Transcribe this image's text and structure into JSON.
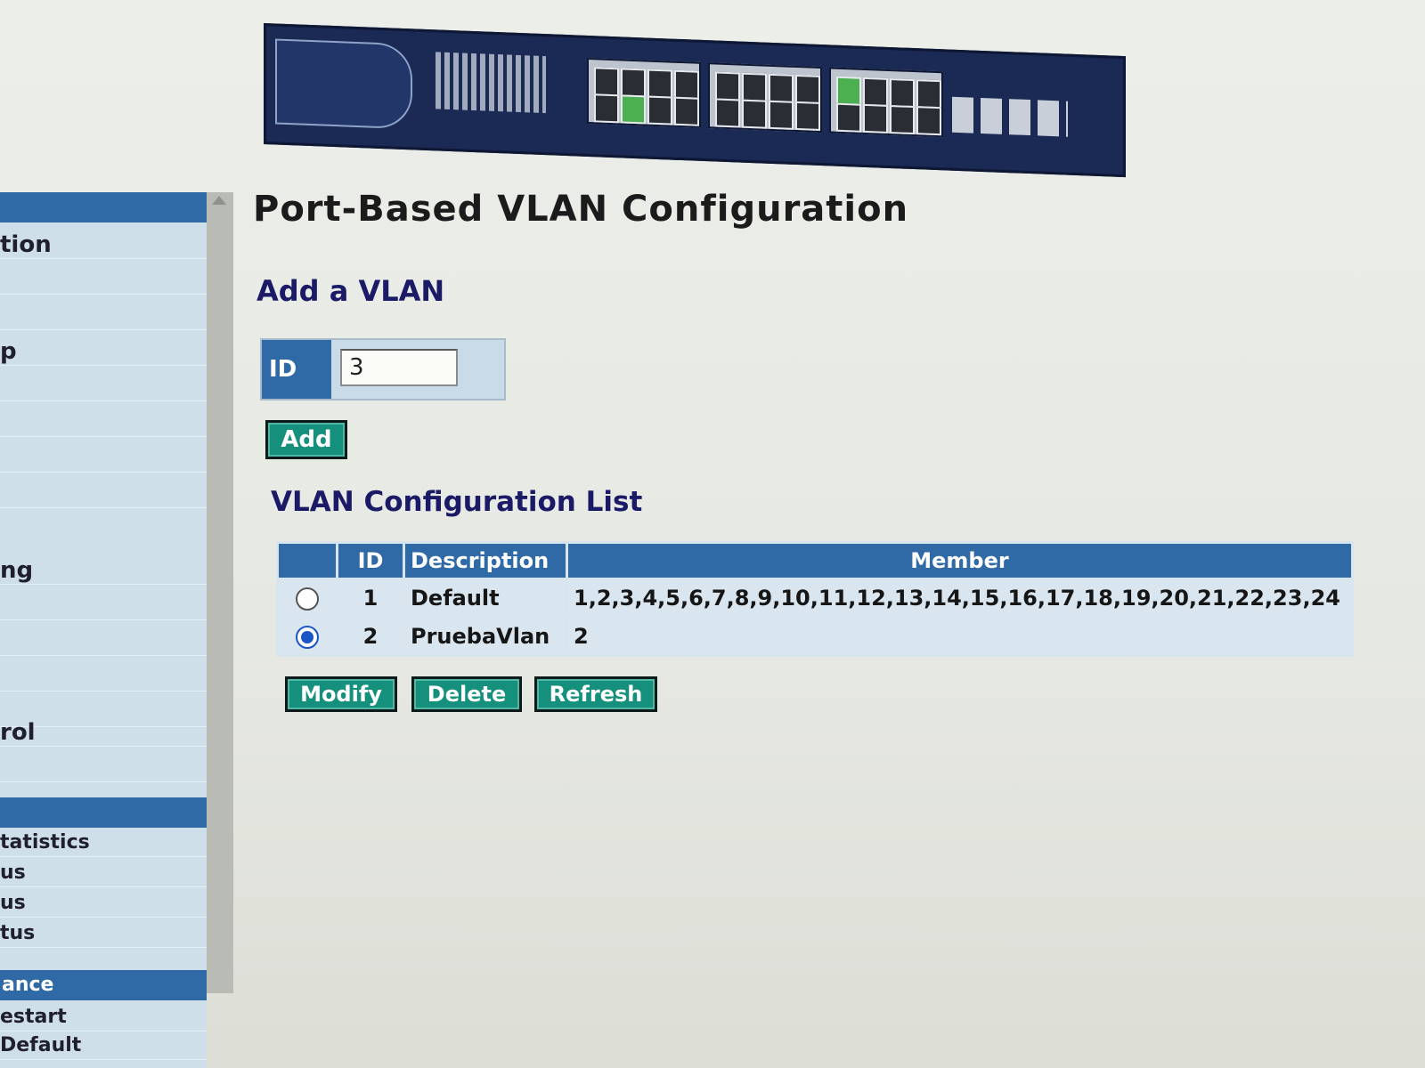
{
  "sidebar": {
    "items": [
      {
        "label": "tion"
      },
      {
        "label": ""
      },
      {
        "label": ""
      },
      {
        "label": "p"
      },
      {
        "label": ""
      },
      {
        "label": ""
      },
      {
        "label": ""
      },
      {
        "label": ""
      },
      {
        "label": "ng"
      },
      {
        "label": ""
      },
      {
        "label": ""
      },
      {
        "label": ""
      },
      {
        "label": ""
      },
      {
        "label": "rol"
      },
      {
        "label": ""
      }
    ],
    "section2_items": [
      {
        "label": "tatistics"
      },
      {
        "label": "us"
      },
      {
        "label": "us"
      },
      {
        "label": "tus"
      }
    ],
    "section3_title": "ance",
    "section3_items": [
      {
        "label": "estart"
      },
      {
        "label": "Default"
      }
    ]
  },
  "page": {
    "title": "Port-Based VLAN Configuration",
    "add_section_title": "Add a VLAN",
    "id_label": "ID",
    "id_value": "3",
    "add_button": "Add",
    "list_title": "VLAN Configuration List"
  },
  "table": {
    "headers": {
      "select": "",
      "id": "ID",
      "description": "Description",
      "member": "Member"
    },
    "rows": [
      {
        "selected": false,
        "id": "1",
        "description": "Default",
        "member": "1,2,3,4,5,6,7,8,9,10,11,12,13,14,15,16,17,18,19,20,21,22,23,24"
      },
      {
        "selected": true,
        "id": "2",
        "description": "PruebaVlan",
        "member": "2"
      }
    ]
  },
  "actions": {
    "modify": "Modify",
    "delete": "Delete",
    "refresh": "Refresh"
  },
  "colors": {
    "header_blue": "#2f6aa6",
    "button_teal": "#15907c",
    "title_navy": "#1a1a66"
  },
  "icons": {
    "banner": "network-switch-image"
  }
}
